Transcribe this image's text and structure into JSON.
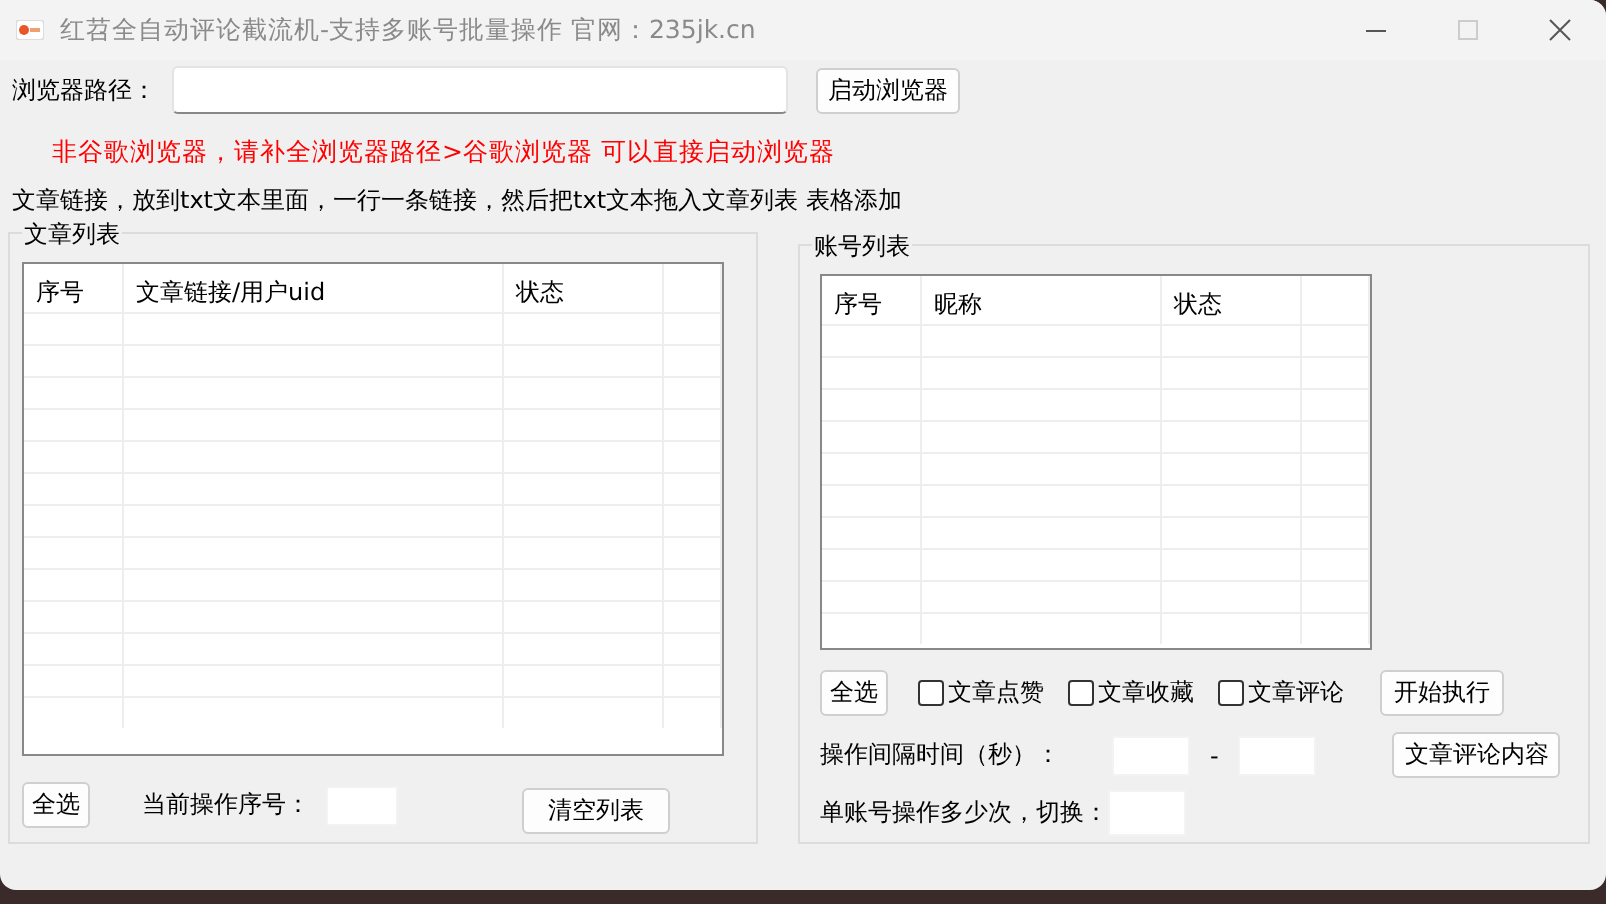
{
  "window": {
    "title": "红苕全自动评论截流机-支持多账号批量操作  官网：235jk.cn",
    "controls": [
      {
        "kind": "minimize",
        "disabled": false
      },
      {
        "kind": "maximize",
        "disabled": true
      },
      {
        "kind": "close",
        "disabled": false
      }
    ]
  },
  "browser_path": {
    "label": "浏览器路径：",
    "button": "启动浏览器"
  },
  "warning": "非谷歌浏览器，请补全浏览器路径>谷歌浏览器  可以直接启动浏览器",
  "instructions": "文章链接，放到txt文本里面，一行一条链接，然后把txt文本拖入文章列表 表格添加",
  "article_list": {
    "title": "文章列表",
    "columns": [
      "序号",
      "文章链接/用户uid",
      "状态"
    ],
    "select_all": "全选",
    "current_label": "当前操作序号：",
    "clear_button": "清空列表"
  },
  "account_list": {
    "title": "账号列表",
    "columns": [
      "序号",
      "昵称",
      "状态"
    ],
    "select_all": "全选",
    "options": [
      {
        "label": "文章点赞",
        "checked": false
      },
      {
        "label": "文章收藏",
        "checked": false
      },
      {
        "label": "文章评论",
        "checked": false
      }
    ],
    "start_button": "开始执行",
    "interval_label": "操作间隔时间（秒）：",
    "interval_dash": "-",
    "comment_button": "文章评论内容",
    "switch_label": "单账号操作多少次，切换："
  }
}
